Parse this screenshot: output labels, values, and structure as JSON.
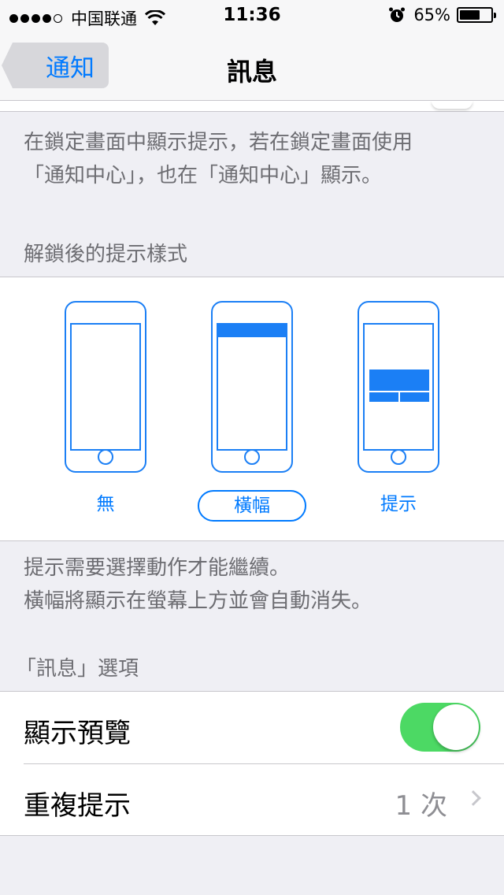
{
  "status_bar": {
    "carrier": "中国联通",
    "time": "11:36",
    "battery_percent": "65%",
    "battery_level": 0.65,
    "signal_bars": 4,
    "signal_total": 5,
    "icons": [
      "wifi-icon",
      "alarm-icon",
      "battery-icon"
    ]
  },
  "nav": {
    "back_label": "通知",
    "title": "訊息"
  },
  "lock_footer": {
    "line1": "在鎖定畫面中顯示提示，若在鎖定畫面使用",
    "line2": "「通知中心」，也在「通知中心」顯示。"
  },
  "alert_style": {
    "header": "解鎖後的提示樣式",
    "options": [
      {
        "label": "無",
        "selected": false
      },
      {
        "label": "橫幅",
        "selected": true
      },
      {
        "label": "提示",
        "selected": false
      }
    ],
    "footer_line1": "提示需要選擇動作才能繼續。",
    "footer_line2": "橫幅將顯示在螢幕上方並會自動消失。"
  },
  "options": {
    "header": "「訊息」選項",
    "show_preview": {
      "label": "顯示預覽",
      "enabled": true
    },
    "repeat_alert": {
      "label": "重複提示",
      "value": "1 次"
    }
  },
  "colors": {
    "accent": "#007aff",
    "toggle_on": "#4cd964",
    "background": "#efeff4"
  }
}
